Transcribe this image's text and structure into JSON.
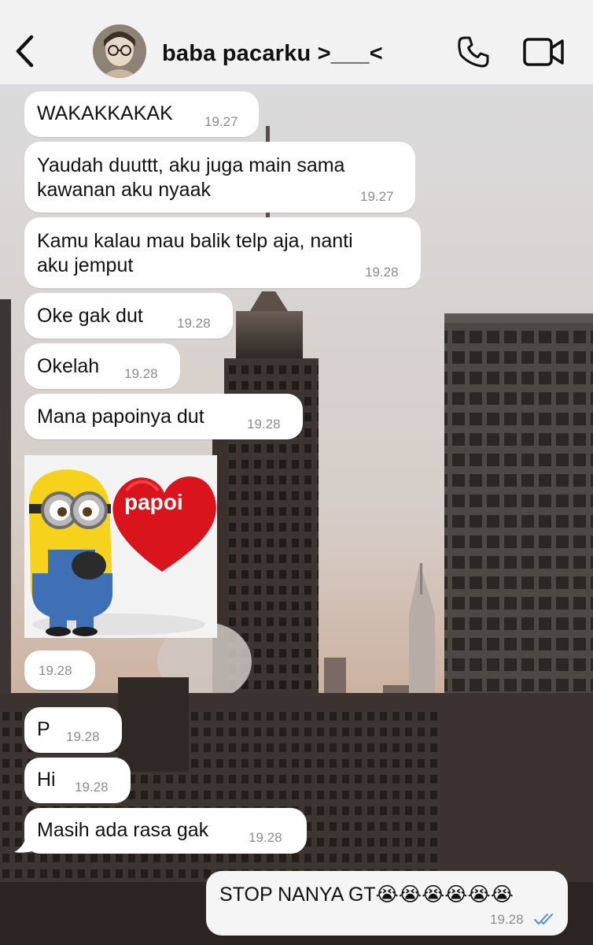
{
  "header": {
    "contact_name": "baba pacarku >___<",
    "icons": {
      "back": "chevron-left-icon",
      "call": "phone-icon",
      "video": "video-camera-icon"
    }
  },
  "messages": [
    {
      "text": "WAKAKKAKAK",
      "time": "19.27"
    },
    {
      "line1": "Yaudah duuttt, aku juga main sama",
      "line2": "kawanan aku nyaak",
      "time": "19.27"
    },
    {
      "line1": "Kamu kalau mau balik telp aja, nanti",
      "line2": "aku jemput",
      "time": "19.28"
    },
    {
      "text": "Oke gak dut",
      "time": "19.28"
    },
    {
      "text": "Okelah",
      "time": "19.28"
    },
    {
      "text": "Mana papoinya dut",
      "time": "19.28"
    },
    {
      "sticker_text": "papoi",
      "time": "19.28"
    },
    {
      "text": "P",
      "time": "19.28"
    },
    {
      "text": "Hi",
      "time": "19.28"
    },
    {
      "text": "Masih ada rasa gak",
      "time": "19.28"
    }
  ],
  "outgoing": {
    "text": "STOP NANYA GT😭😭😭😭😭😭",
    "time": "19.28",
    "status": "read"
  },
  "colors": {
    "bubble_in": "#ffffff",
    "bubble_out": "#f5f5f5",
    "tick": "#4a90e2",
    "header_bg": "#f2f2f2"
  }
}
